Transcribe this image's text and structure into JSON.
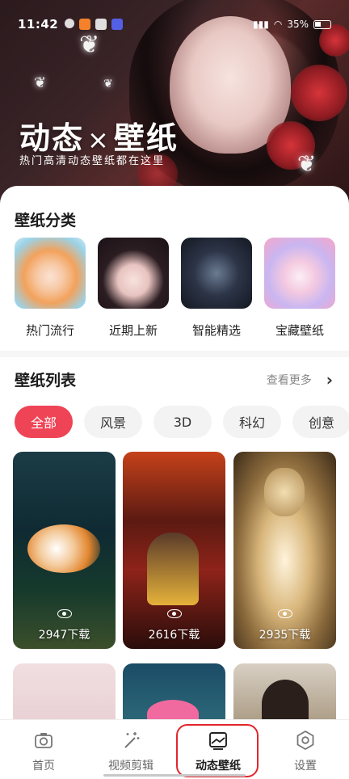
{
  "status_bar": {
    "time": "11:42",
    "battery": "35%"
  },
  "hero": {
    "title_left": "动态",
    "title_sep": "×",
    "title_right": "壁纸",
    "subtitle": "热门高清动态壁纸都在这里"
  },
  "categories_section": {
    "title": "壁纸分类",
    "items": [
      {
        "label": "热门流行",
        "icon": "anime-girl-orange-hair"
      },
      {
        "label": "近期上新",
        "icon": "anime-girl-black-hair"
      },
      {
        "label": "智能精选",
        "icon": "anime-boy-dark"
      },
      {
        "label": "宝藏壁纸",
        "icon": "anime-girl-pastel"
      }
    ]
  },
  "list_section": {
    "title": "壁纸列表",
    "more_label": "查看更多",
    "filters": [
      "全部",
      "风景",
      "3D",
      "科幻",
      "创意"
    ],
    "active_filter": "全部",
    "cards": [
      {
        "count": "2947下载",
        "subject": "koi-fish-underwater"
      },
      {
        "count": "2616下载",
        "subject": "basketball-player-fire"
      },
      {
        "count": "2935下载",
        "subject": "golden-buddha"
      }
    ]
  },
  "bottom_nav": {
    "items": [
      {
        "label": "首页",
        "icon": "camera-icon"
      },
      {
        "label": "视频剪辑",
        "icon": "magic-wand-icon"
      },
      {
        "label": "动态壁纸",
        "icon": "image-icon"
      },
      {
        "label": "设置",
        "icon": "gear-icon"
      }
    ],
    "active": "动态壁纸"
  },
  "colors": {
    "accent": "#ef4456",
    "highlight_box": "#e2262c"
  }
}
